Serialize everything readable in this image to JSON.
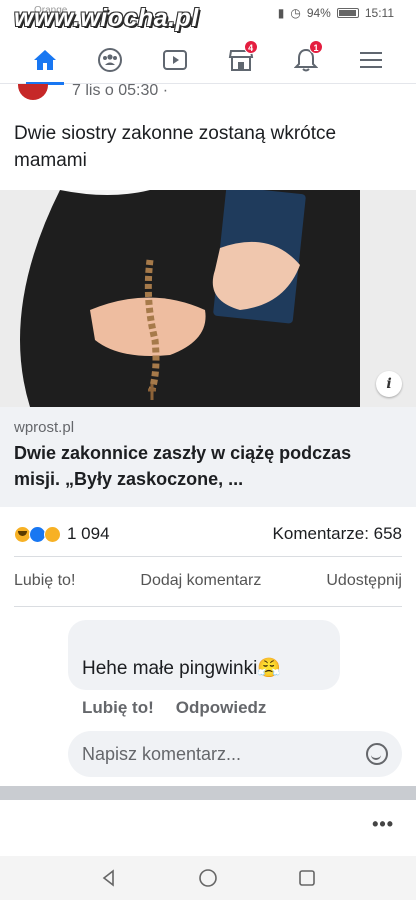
{
  "status_bar": {
    "carrier": "Orange",
    "battery_percent": "94%",
    "clock": "15:11"
  },
  "watermark": {
    "text": "www.wiocha.pl"
  },
  "nav": {
    "items": [
      {
        "name": "home",
        "icon": "home-icon",
        "active": true
      },
      {
        "name": "groups",
        "icon": "groups-icon",
        "active": false
      },
      {
        "name": "watch",
        "icon": "video-icon",
        "active": false
      },
      {
        "name": "marketplace",
        "icon": "store-icon",
        "badge": "4",
        "active": false
      },
      {
        "name": "notifications",
        "icon": "bell-icon",
        "badge": "1",
        "active": false
      },
      {
        "name": "menu",
        "icon": "hamburger-icon",
        "active": false
      }
    ],
    "accent_color": "#1877f2",
    "badge_color": "#e41e3f"
  },
  "post": {
    "timestamp": "7 lis o 05:30 ·",
    "text": "Dwie siostry zakonne zostaną wkrótce mamami",
    "image_icon": "nun-with-bible-and-rosary-image",
    "info_label": "i",
    "link": {
      "domain": "wprost.pl",
      "title": "Dwie zakonnice zaszły w ciążę podczas misji. „Były zaskoczone, ..."
    },
    "reactions": {
      "icons": [
        "haha-icon",
        "like-icon",
        "wow-icon"
      ],
      "count": "1 094"
    },
    "comments_count": "Komentarze: 658",
    "actions": {
      "like": "Lubię to!",
      "comment": "Dodaj komentarz",
      "share": "Udostępnij"
    }
  },
  "comment": {
    "text": "Hehe małe pingwinki😤",
    "like": "Lubię to!",
    "reply": "Odpowiedz"
  },
  "compose": {
    "placeholder": "Napisz komentarz..."
  },
  "next_post": {
    "more_label": "•••"
  },
  "android_nav": {
    "buttons": [
      "back-icon",
      "home-circle-icon",
      "recents-icon"
    ]
  }
}
